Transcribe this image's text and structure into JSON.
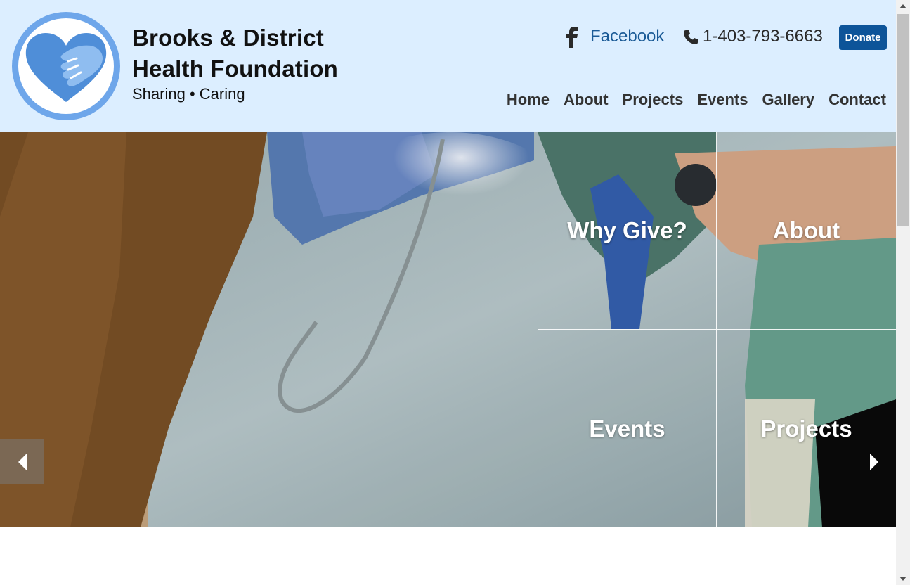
{
  "site": {
    "title_line1": "Brooks & District",
    "title_line2": "Health Foundation",
    "tagline": "Sharing • Caring"
  },
  "header": {
    "facebook_label": "Facebook",
    "phone": "1-403-793-6663",
    "donate_label": "Donate"
  },
  "nav": {
    "items": [
      {
        "label": "Home"
      },
      {
        "label": "About"
      },
      {
        "label": "Projects"
      },
      {
        "label": "Events"
      },
      {
        "label": "Gallery"
      },
      {
        "label": "Contact"
      }
    ]
  },
  "hero": {
    "tiles": [
      {
        "label": "Why Give?"
      },
      {
        "label": "About"
      },
      {
        "label": "Events"
      },
      {
        "label": "Projects"
      }
    ],
    "prev_icon": "caret-left-icon",
    "next_icon": "caret-right-icon"
  },
  "colors": {
    "header_bg": "#dceeff",
    "donate_bg": "#0d5499",
    "link": "#1a5a96",
    "logo_ring": "#6ea6ea"
  }
}
